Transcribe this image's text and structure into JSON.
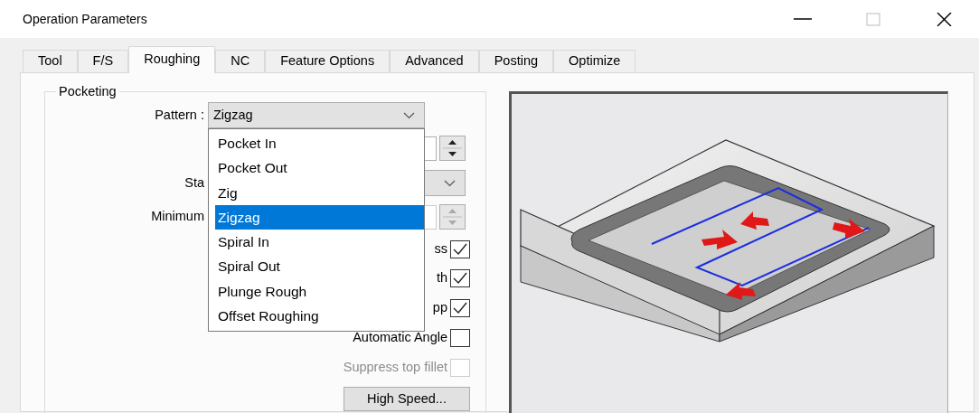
{
  "window": {
    "title": "Operation Parameters"
  },
  "tabs": [
    {
      "label": "Tool",
      "selected": false
    },
    {
      "label": "F/S",
      "selected": false
    },
    {
      "label": "Roughing",
      "selected": true
    },
    {
      "label": "NC",
      "selected": false
    },
    {
      "label": "Feature Options",
      "selected": false
    },
    {
      "label": "Advanced",
      "selected": false
    },
    {
      "label": "Posting",
      "selected": false
    },
    {
      "label": "Optimize",
      "selected": false
    }
  ],
  "group": {
    "title": "Pocketing"
  },
  "pattern": {
    "label": "Pattern :",
    "value": "Zigzag",
    "expanded": true,
    "options": [
      {
        "label": "Pocket In",
        "selected": false
      },
      {
        "label": "Pocket Out",
        "selected": false
      },
      {
        "label": "Zig",
        "selected": false
      },
      {
        "label": "Zigzag",
        "selected": true
      },
      {
        "label": "Spiral In",
        "selected": false
      },
      {
        "label": "Spiral Out",
        "selected": false
      },
      {
        "label": "Plunge Rough",
        "selected": false
      },
      {
        "label": "Offset Roughing",
        "selected": false
      }
    ]
  },
  "fields": [
    {
      "kind": "spinner",
      "disabled": false
    },
    {
      "kind": "combo",
      "label": "Sta",
      "disabled": false
    },
    {
      "kind": "spinner",
      "label": "Minimum",
      "disabled": true
    }
  ],
  "checkboxes": [
    {
      "label": "ss",
      "checked": true,
      "disabled": false
    },
    {
      "label": "th",
      "checked": true,
      "disabled": false
    },
    {
      "label": "pp",
      "checked": true,
      "disabled": false
    },
    {
      "label": "Automatic Angle",
      "checked": false,
      "disabled": false
    },
    {
      "label": "Suppress top fillet",
      "checked": false,
      "disabled": true
    }
  ],
  "buttons": [
    {
      "label": "High Speed..."
    }
  ]
}
